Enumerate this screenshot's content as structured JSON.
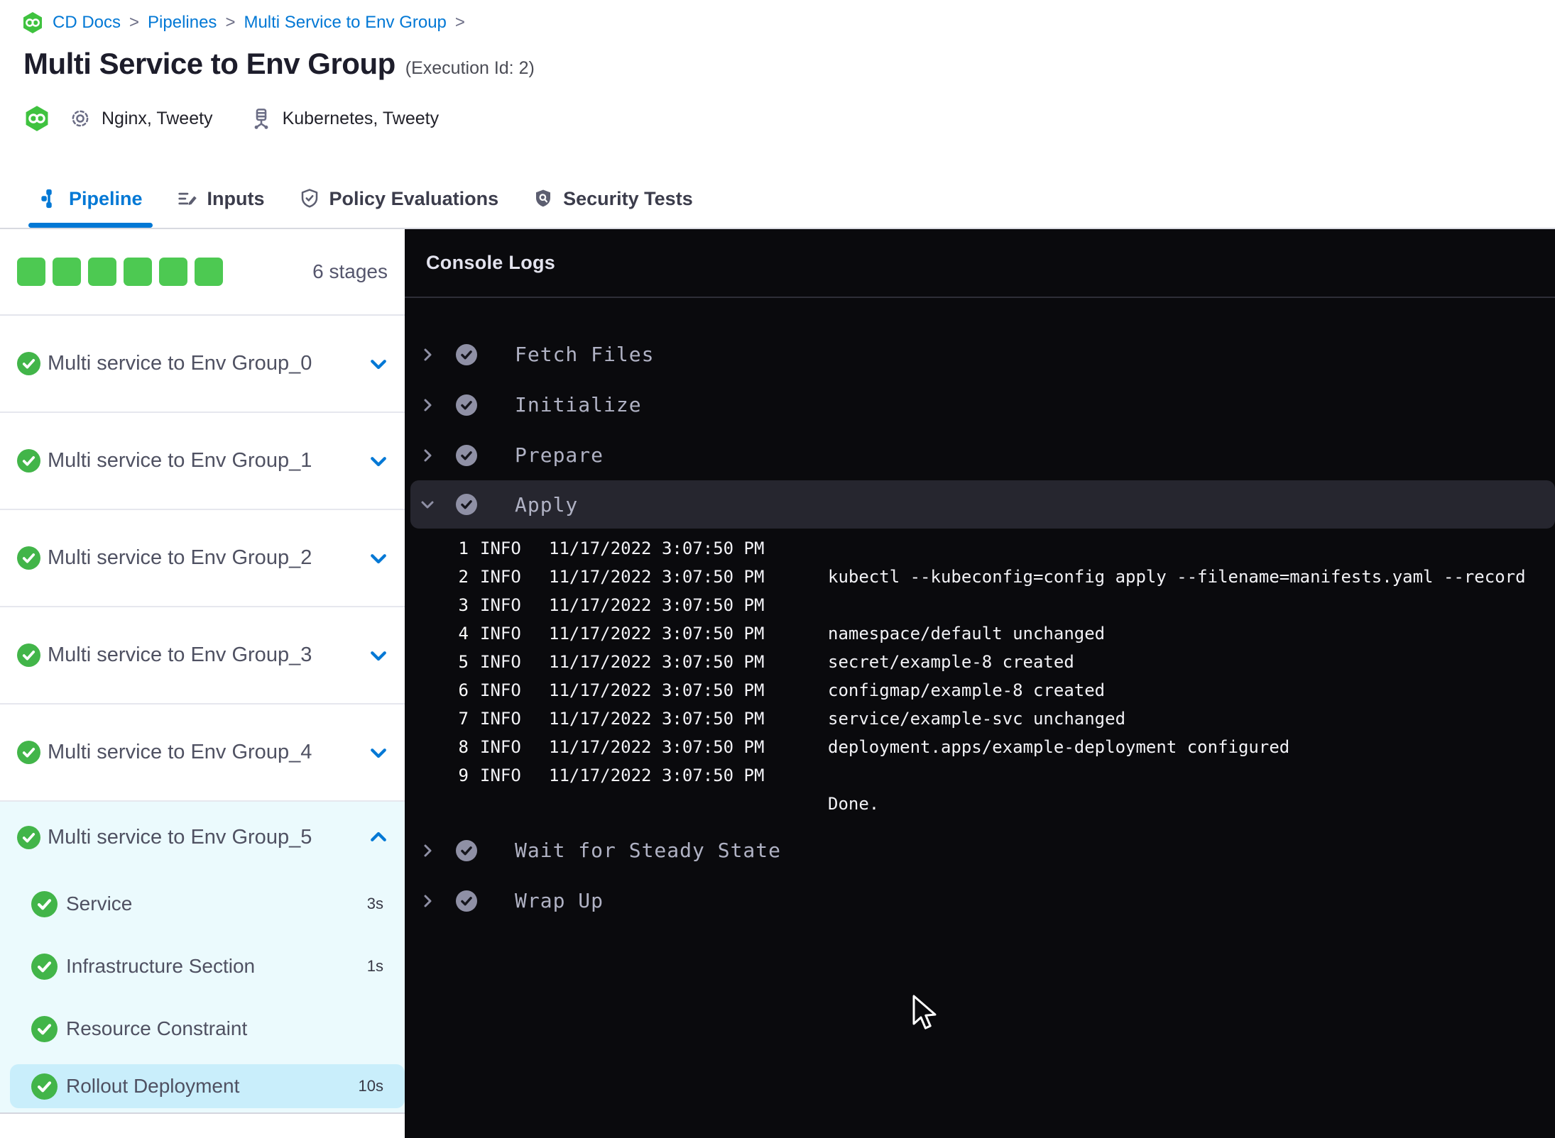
{
  "colors": {
    "accent_blue": "#0278d5",
    "success_green_square": "#4dc952",
    "success_green_circle": "#42b549",
    "console_bg": "#0a0a0d",
    "console_row_highlight": "#26262f",
    "expanded_group_bg": "#ebfafd",
    "selected_step_bg": "#c9eefb"
  },
  "breadcrumb": {
    "logo_icon": "harness-cd-icon",
    "items": [
      "CD Docs",
      "Pipelines",
      "Multi Service to Env Group"
    ],
    "separator": ">"
  },
  "header": {
    "title": "Multi Service to Env Group",
    "execution_id": "(Execution Id: 2)",
    "services_icon": "gear-icon",
    "services": "Nginx, Tweety",
    "environments_icon": "environment-icon",
    "environments": "Kubernetes, Tweety"
  },
  "tabs": [
    {
      "label": "Pipeline",
      "icon": "pipeline-icon",
      "active": true
    },
    {
      "label": "Inputs",
      "icon": "inputs-icon",
      "active": false
    },
    {
      "label": "Policy Evaluations",
      "icon": "policy-evaluations-icon",
      "active": false
    },
    {
      "label": "Security Tests",
      "icon": "security-tests-icon",
      "active": false
    }
  ],
  "stages_panel": {
    "stage_count": 6,
    "count_label": "6 stages",
    "stages": [
      {
        "label": "Multi service to Env Group_0",
        "status": "success",
        "expanded": false
      },
      {
        "label": "Multi service to Env Group_1",
        "status": "success",
        "expanded": false
      },
      {
        "label": "Multi service to Env Group_2",
        "status": "success",
        "expanded": false
      },
      {
        "label": "Multi service to Env Group_3",
        "status": "success",
        "expanded": false
      },
      {
        "label": "Multi service to Env Group_4",
        "status": "success",
        "expanded": false
      },
      {
        "label": "Multi service to Env Group_5",
        "status": "success",
        "expanded": true,
        "steps": [
          {
            "label": "Service",
            "duration": "3s",
            "selected": false
          },
          {
            "label": "Infrastructure Section",
            "duration": "1s",
            "selected": false
          },
          {
            "label": "Resource Constraint",
            "duration": "",
            "selected": false
          },
          {
            "label": "Rollout Deployment",
            "duration": "10s",
            "selected": true
          }
        ]
      }
    ]
  },
  "console": {
    "title": "Console Logs",
    "steps": [
      {
        "label": "Fetch Files",
        "status": "success",
        "expanded": false
      },
      {
        "label": "Initialize",
        "status": "success",
        "expanded": false
      },
      {
        "label": "Prepare",
        "status": "success",
        "expanded": false
      },
      {
        "label": "Apply",
        "status": "success",
        "expanded": true,
        "logs": [
          {
            "n": "1",
            "level": "INFO",
            "time": "11/17/2022 3:07:50 PM",
            "message": ""
          },
          {
            "n": "2",
            "level": "INFO",
            "time": "11/17/2022 3:07:50 PM",
            "message": "kubectl --kubeconfig=config apply --filename=manifests.yaml --record"
          },
          {
            "n": "3",
            "level": "INFO",
            "time": "11/17/2022 3:07:50 PM",
            "message": ""
          },
          {
            "n": "4",
            "level": "INFO",
            "time": "11/17/2022 3:07:50 PM",
            "message": "namespace/default unchanged"
          },
          {
            "n": "5",
            "level": "INFO",
            "time": "11/17/2022 3:07:50 PM",
            "message": "secret/example-8 created"
          },
          {
            "n": "6",
            "level": "INFO",
            "time": "11/17/2022 3:07:50 PM",
            "message": "configmap/example-8 created"
          },
          {
            "n": "7",
            "level": "INFO",
            "time": "11/17/2022 3:07:50 PM",
            "message": "service/example-svc unchanged"
          },
          {
            "n": "8",
            "level": "INFO",
            "time": "11/17/2022 3:07:50 PM",
            "message": "deployment.apps/example-deployment configured"
          },
          {
            "n": "9",
            "level": "INFO",
            "time": "11/17/2022 3:07:50 PM",
            "message": ""
          },
          {
            "n": "",
            "level": "",
            "time": "",
            "message": "Done."
          }
        ]
      },
      {
        "label": "Wait for Steady State",
        "status": "success",
        "expanded": false
      },
      {
        "label": "Wrap Up",
        "status": "success",
        "expanded": false
      }
    ]
  }
}
